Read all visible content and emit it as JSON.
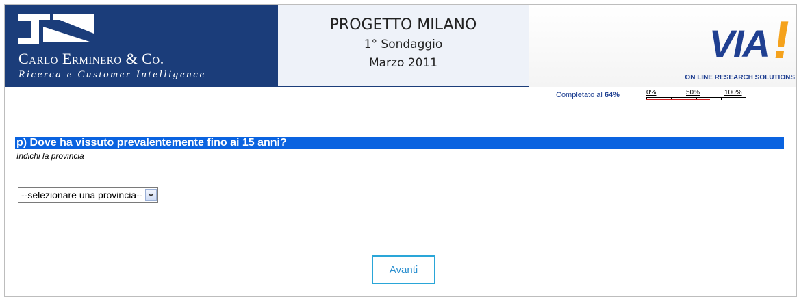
{
  "header": {
    "company_name_first": "Carlo",
    "company_name_rest": " Erminero & Co.",
    "tagline": "Ricerca e Customer Intelligence",
    "title": "PROGETTO MILANO",
    "subtitle": "1° Sondaggio",
    "date": "Marzo 2011",
    "via_logo_text": "VIA",
    "via_logo_bang": "!",
    "via_subtitle": "ON LINE RESEARCH SOLUTIONS"
  },
  "progress": {
    "label_prefix": "Completato al",
    "label_value": "64%",
    "percent": 64,
    "scale_labels": [
      "0%",
      "50%",
      "100%"
    ]
  },
  "question": {
    "text": "p) Dove ha vissuto prevalentemente fino ai 15 anni?",
    "hint": "Indichi la provincia"
  },
  "province_select": {
    "selected": "--selezionare una provincia--"
  },
  "next_button": {
    "label": "Avanti"
  },
  "colors": {
    "brand_navy": "#1b3d7a",
    "question_bar": "#0a63e0",
    "via_blue": "#1f3f91",
    "via_orange": "#f5a21c",
    "progress_fill": "#d21f1f",
    "button_border": "#2aa6d8"
  }
}
